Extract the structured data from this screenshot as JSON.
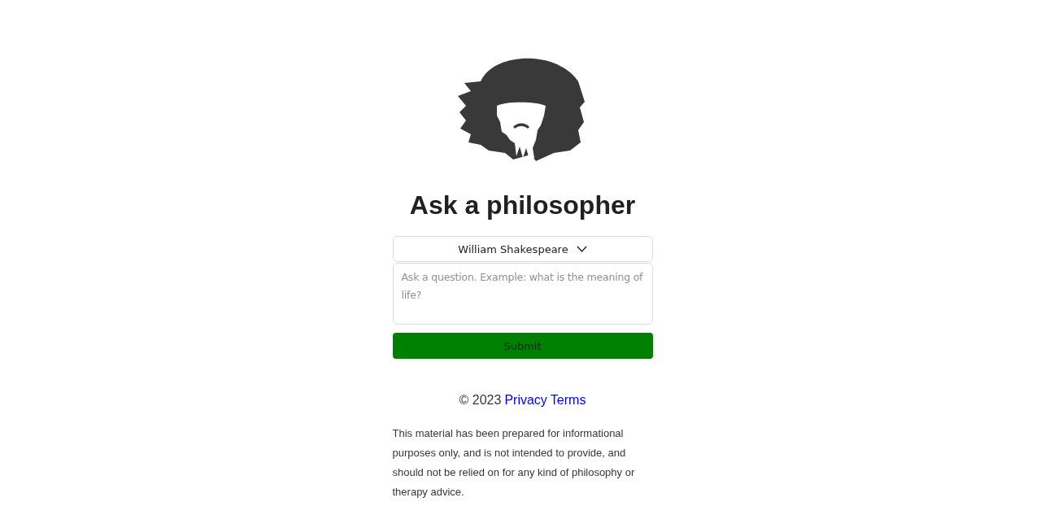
{
  "title": "Ask a philosopher",
  "philosopher_select": {
    "value": "William Shakespeare"
  },
  "question": {
    "placeholder": "Ask a question. Example: what is the meaning of life?"
  },
  "submit": {
    "label": "Submit",
    "disabled": true
  },
  "footer": {
    "copyright": "© 2023",
    "links": [
      "Privacy",
      "Terms"
    ]
  },
  "disclaimer": "This material has been prepared for informational purposes only, and is not intended to provide, and should not be relied on for any kind of philosophy or therapy advice."
}
